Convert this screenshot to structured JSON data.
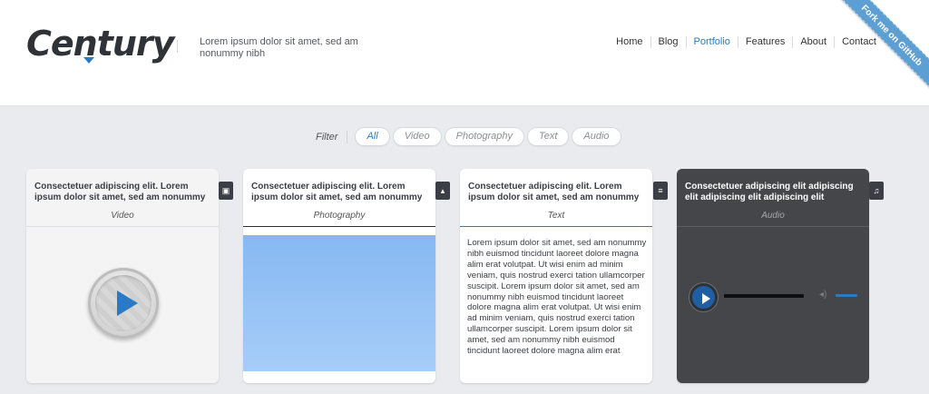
{
  "brand": {
    "logo": "Century",
    "tagline": "Lorem ipsum dolor sit amet, sed am nonummy nibh"
  },
  "nav": [
    "Home",
    "Blog",
    "Portfolio",
    "Features",
    "About",
    "Contact"
  ],
  "nav_active": "Portfolio",
  "ribbon": "Fork me on GitHub",
  "filter": {
    "label": "Filter",
    "options": [
      "All",
      "Video",
      "Photography",
      "Text",
      "Audio"
    ],
    "active": "All"
  },
  "cards": [
    {
      "title": "Consectetuer adipiscing elit. Lorem ipsum dolor sit amet, sed am nonummy",
      "category": "Video",
      "icon": "film-icon"
    },
    {
      "title": "Consectetuer adipiscing elit. Lorem ipsum dolor sit amet, sed am nonummy",
      "category": "Photography",
      "icon": "image-icon"
    },
    {
      "title": "Consectetuer adipiscing elit. Lorem ipsum dolor sit amet, sed am nonummy",
      "category": "Text",
      "icon": "text-icon",
      "body": "Lorem ipsum dolor sit amet, sed am nonummy nibh euismod tincidunt laoreet dolore magna alim erat volutpat. Ut wisi enim ad minim veniam, quis nostrud exerci tation ullamcorper suscipit. Lorem ipsum dolor sit amet, sed am nonummy nibh euismod tincidunt laoreet dolore magna alim erat volutpat. Ut wisi enim ad minim veniam, quis nostrud exerci tation ullamcorper suscipit. Lorem ipsum dolor sit amet, sed am nonummy nibh euismod tincidunt laoreet dolore magna alim erat"
    },
    {
      "title": "Consectetuer adipiscing elit adipiscing elit adipiscing elit adipiscing elit",
      "category": "Audio",
      "icon": "music-icon"
    }
  ],
  "colors": {
    "accent": "#2b7bc3",
    "background": "#e9ebee",
    "audio_card": "#444649"
  }
}
